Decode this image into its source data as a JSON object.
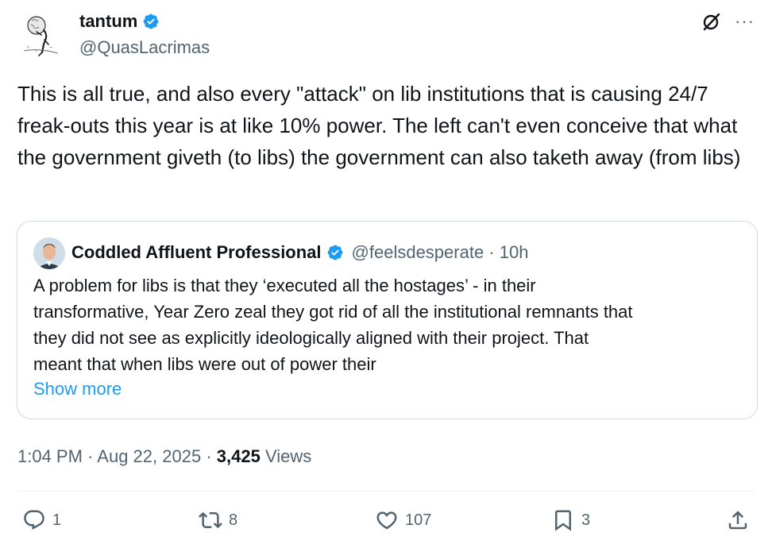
{
  "author": {
    "name": "tantum",
    "handle": "@QuasLacrimas",
    "avatar_icon": "sisyphus-sketch-avatar"
  },
  "header_icons": [
    "grok-icon",
    "more-options-icon"
  ],
  "more_glyph": "···",
  "tweet": {
    "text": "This is all true, and also every \"attack\" on lib institutions that is causing 24/7 freak-outs this year is at like 10% power. The left can't even conceive that what the government giveth (to libs) the government can also taketh away (from libs)"
  },
  "quote": {
    "name": "Coddled Affluent Professional",
    "handle": "@feelsdesperate",
    "separator": "·",
    "age": "10h",
    "lines": [
      "A problem for libs is that they ‘executed all the hostages’ - in their",
      "transformative, Year Zero zeal they got rid of all the institutional remnants that",
      "they did not see as explicitly ideologically aligned with their project. That",
      "meant that when libs were out of power their"
    ],
    "show_more": "Show more"
  },
  "meta": {
    "time": "1:04 PM",
    "date": "Aug 22, 2025",
    "separator": "·",
    "views_count": "3,425",
    "views_label": "Views"
  },
  "actions": {
    "replies": "1",
    "reposts": "8",
    "likes": "107",
    "bookmarks": "3"
  },
  "colors": {
    "text": "#0f1419",
    "secondary": "#536471",
    "link": "#1d9bf0",
    "verified": "#1d9bf0",
    "border": "#cfd9de"
  }
}
